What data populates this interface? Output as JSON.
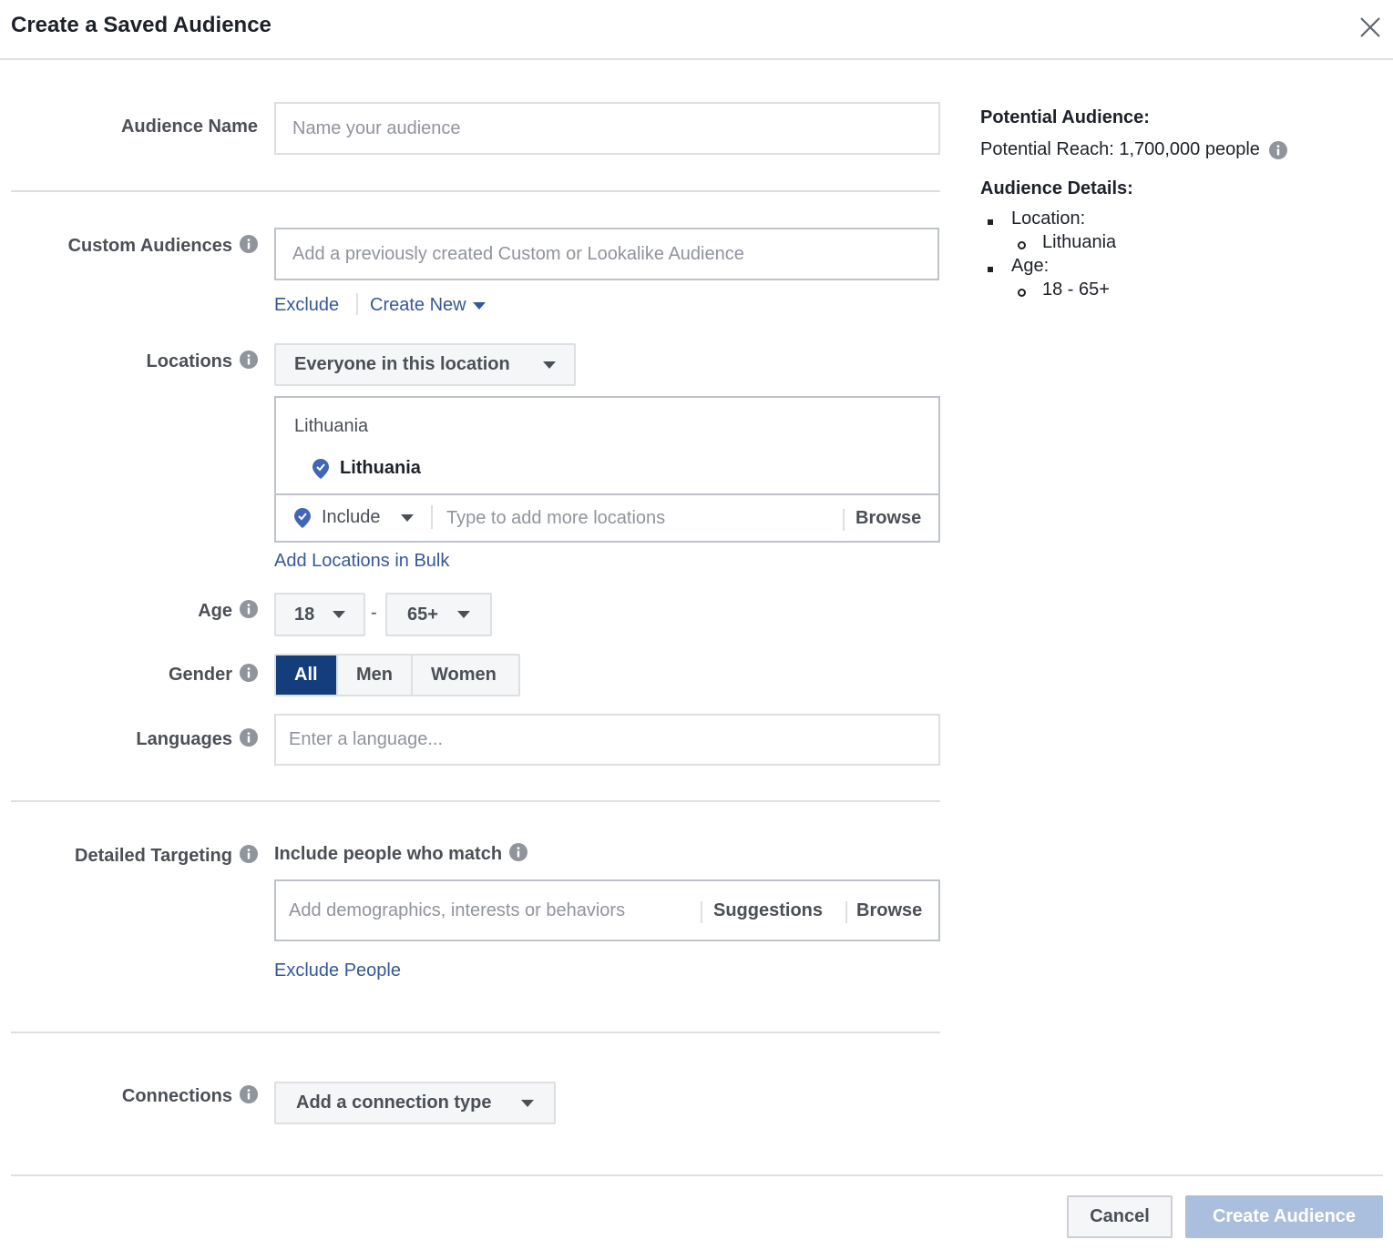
{
  "dialog": {
    "title": "Create a Saved Audience",
    "close_icon": "close-icon"
  },
  "audience_name": {
    "label": "Audience Name",
    "placeholder": "Name your audience",
    "value": ""
  },
  "custom_audiences": {
    "label": "Custom Audiences",
    "placeholder": "Add a previously created Custom or Lookalike Audience",
    "exclude_link": "Exclude",
    "create_new_link": "Create New"
  },
  "locations": {
    "label": "Locations",
    "dropdown_value": "Everyone in this location",
    "box_header": "Lithuania",
    "selected": [
      "Lithuania"
    ],
    "include_label": "Include",
    "search_placeholder": "Type to add more locations",
    "browse_label": "Browse",
    "bulk_link": "Add Locations in Bulk"
  },
  "age": {
    "label": "Age",
    "min": "18",
    "separator": "-",
    "max": "65+"
  },
  "gender": {
    "label": "Gender",
    "options": [
      "All",
      "Men",
      "Women"
    ],
    "selected": "All"
  },
  "languages": {
    "label": "Languages",
    "placeholder": "Enter a language..."
  },
  "detailed_targeting": {
    "label": "Detailed Targeting",
    "subheading": "Include people who match",
    "placeholder": "Add demographics, interests or behaviors",
    "suggestions_label": "Suggestions",
    "browse_label": "Browse",
    "exclude_link": "Exclude People"
  },
  "connections": {
    "label": "Connections",
    "dropdown_value": "Add a connection type"
  },
  "potential_audience": {
    "heading": "Potential Audience:",
    "reach_text": "Potential Reach: 1,700,000 people",
    "details_heading": "Audience Details:",
    "location_label": "Location:",
    "location_value": "Lithuania",
    "age_label": "Age:",
    "age_value": "18 - 65+"
  },
  "footer": {
    "cancel_label": "Cancel",
    "create_label": "Create Audience"
  },
  "colors": {
    "link": "#365899",
    "selected_gender": "#133d7b",
    "create_button_disabled": "#9cb4d8",
    "border": "#dddfe2"
  }
}
